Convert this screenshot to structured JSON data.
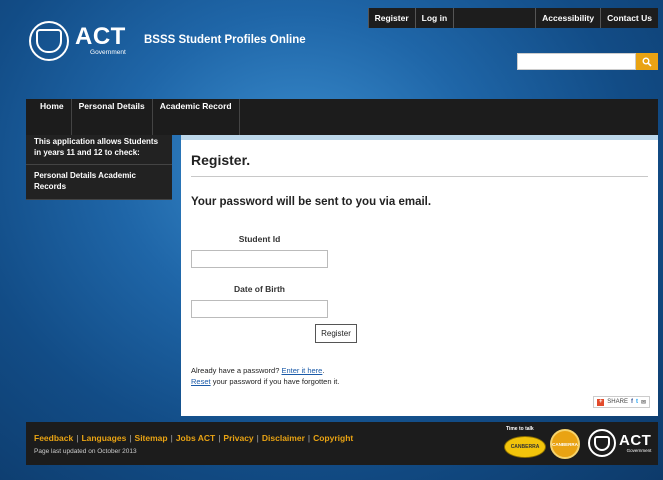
{
  "toplinks": {
    "register": "Register",
    "login": "Log in",
    "accessibility": "Accessibility",
    "contact": "Contact Us"
  },
  "logo": {
    "big": "ACT",
    "small": "Government"
  },
  "site_title": "BSSS Student Profiles Online",
  "search": {
    "value": "",
    "icon": "search-icon"
  },
  "nav": [
    {
      "label": "Home"
    },
    {
      "label": "Personal Details"
    },
    {
      "label": "Academic Record"
    }
  ],
  "sidebar": {
    "intro": "This application allows Students in years 11 and 12 to check:",
    "item": "Personal Details Academic Records"
  },
  "content": {
    "title": "Register.",
    "subtitle": "Your password will be sent to you via email.",
    "student_id_label": "Student Id",
    "dob_label": "Date of Birth",
    "register_button": "Register",
    "already_text": "Already have a password?",
    "enter_link": "Enter it here",
    "reset_link": "Reset",
    "reset_text": "your password if you have forgotten it.",
    "share_label": "SHARE"
  },
  "footer": {
    "links": [
      "Feedback",
      "Languages",
      "Sitemap",
      "Jobs ACT",
      "Privacy",
      "Disclaimer",
      "Copyright"
    ],
    "updated": "Page last updated on October 2013",
    "badge1_top": "Time to talk",
    "badge1": "CANBERRA",
    "badge2": "CANBERRA"
  },
  "colors": {
    "accent": "#e9a313",
    "nav_bg": "#1c1c1c",
    "link": "#1a5aa8"
  }
}
